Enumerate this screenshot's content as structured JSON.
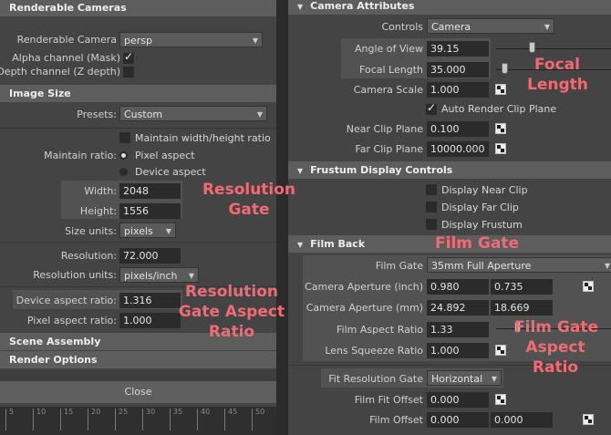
{
  "left": {
    "renderable_cameras": {
      "header": "Renderable Cameras",
      "camera_label": "Renderable Camera",
      "camera_value": "persp",
      "alpha_label": "Alpha channel (Mask)",
      "depth_label": "Depth channel (Z depth)",
      "alpha_checked": true,
      "depth_checked": false
    },
    "image_size": {
      "header": "Image Size",
      "presets_label": "Presets:",
      "presets_value": "Custom",
      "maintain_wh_label": "Maintain width/height ratio",
      "maintain_ratio_label": "Maintain ratio:",
      "pixel_aspect_option": "Pixel aspect",
      "device_aspect_option": "Device aspect",
      "width_label": "Width:",
      "width_value": "2048",
      "height_label": "Height:",
      "height_value": "1556",
      "size_units_label": "Size units:",
      "size_units_value": "pixels",
      "resolution_label": "Resolution:",
      "resolution_value": "72.000",
      "resolution_units_label": "Resolution units:",
      "resolution_units_value": "pixels/inch",
      "device_aspect_label": "Device aspect ratio:",
      "device_aspect_value": "1.316",
      "pixel_aspect_label": "Pixel aspect ratio:",
      "pixel_aspect_value": "1.000"
    },
    "scene_assembly_header": "Scene Assembly",
    "render_options_header": "Render Options",
    "close_button": "Close",
    "ruler_labels": [
      "5",
      "10",
      "15",
      "20",
      "25",
      "30",
      "35",
      "40",
      "45",
      "50"
    ]
  },
  "right": {
    "camera_attributes": {
      "header": "Camera Attributes",
      "controls_label": "Controls",
      "controls_value": "Camera",
      "angle_of_view_label": "Angle of View",
      "angle_of_view_value": "39.15",
      "focal_length_label": "Focal Length",
      "focal_length_value": "35.000",
      "camera_scale_label": "Camera Scale",
      "camera_scale_value": "1.000",
      "auto_clip_label": "Auto Render Clip Plane",
      "near_clip_label": "Near Clip Plane",
      "near_clip_value": "0.100",
      "far_clip_label": "Far Clip Plane",
      "far_clip_value": "10000.000"
    },
    "frustum": {
      "header": "Frustum Display Controls",
      "near_label": "Display Near Clip",
      "far_label": "Display Far Clip",
      "frustum_label": "Display Frustum"
    },
    "film_back": {
      "header": "Film Back",
      "film_gate_label": "Film Gate",
      "film_gate_value": "35mm Full Aperture",
      "aperture_inch_label": "Camera Aperture (inch)",
      "aperture_inch_x": "0.980",
      "aperture_inch_y": "0.735",
      "aperture_mm_label": "Camera Aperture (mm)",
      "aperture_mm_x": "24.892",
      "aperture_mm_y": "18.669",
      "film_aspect_label": "Film Aspect Ratio",
      "film_aspect_value": "1.33",
      "lens_squeeze_label": "Lens Squeeze Ratio",
      "lens_squeeze_value": "1.000",
      "fit_gate_label": "Fit Resolution Gate",
      "fit_gate_value": "Horizontal",
      "film_fit_offset_label": "Film Fit Offset",
      "film_fit_offset_value": "0.000",
      "film_offset_label": "Film Offset",
      "film_offset_x": "0.000",
      "film_offset_y": "0.000"
    }
  },
  "annotations": {
    "resolution_gate": [
      "Resolution",
      "Gate"
    ],
    "resolution_gate_aspect": [
      "Resolution",
      "Gate Aspect",
      "Ratio"
    ],
    "focal_length": [
      "Focal",
      "Length"
    ],
    "film_gate": "Film Gate",
    "film_gate_aspect": [
      "Film Gate",
      "Aspect",
      "Ratio"
    ]
  },
  "colors": {
    "annotation": "#f06b73",
    "panel_bg": "#444444",
    "header_bg": "#5d5d5d",
    "field_bg": "#2b2b2b"
  }
}
